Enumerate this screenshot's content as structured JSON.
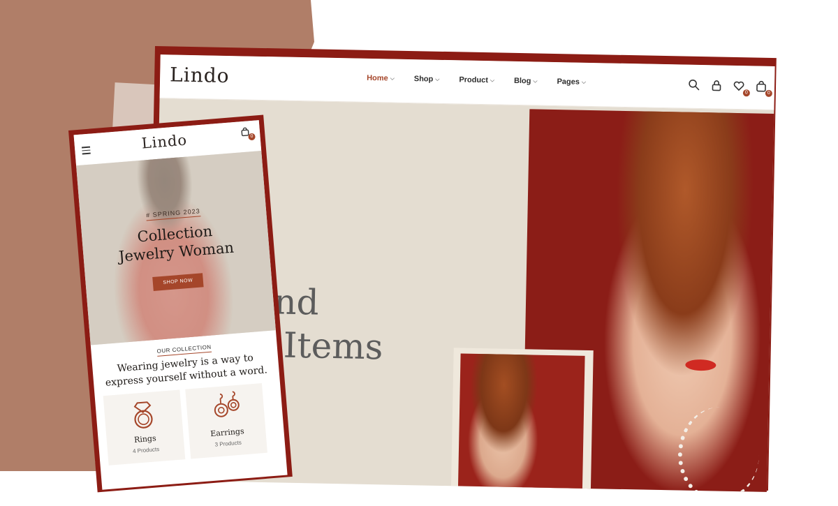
{
  "desktop": {
    "logo": "Lindo",
    "nav": [
      {
        "label": "Home",
        "active": true
      },
      {
        "label": "Shop",
        "active": false
      },
      {
        "label": "Product",
        "active": false
      },
      {
        "label": "Blog",
        "active": false
      },
      {
        "label": "Pages",
        "active": false
      }
    ],
    "header_icons": [
      "search-icon",
      "lock-icon",
      "heart-icon",
      "cart-icon"
    ],
    "wishlist_count": "0",
    "cart_count": "0",
    "hero_line1": "-End",
    "hero_line2": "ry Items"
  },
  "mobile": {
    "logo": "Lindo",
    "cart_count": "0",
    "tagline": "# SPRING 2023",
    "title_line1": "Collection",
    "title_line2": "Jewelry Woman",
    "shop_button": "SHOP NOW",
    "collection_label": "OUR COLLECTION",
    "collection_line1": "Wearing jewelry is a way to",
    "collection_line2": "express yourself without a word.",
    "categories": [
      {
        "name": "Rings",
        "count": "4 Products",
        "icon": "ring-icon"
      },
      {
        "name": "Earrings",
        "count": "3 Products",
        "icon": "earrings-icon"
      }
    ]
  },
  "colors": {
    "accent": "#a5462a",
    "frame": "#8c1c14",
    "background_block": "#b07e68",
    "hero_beige": "#e4ddd1"
  }
}
